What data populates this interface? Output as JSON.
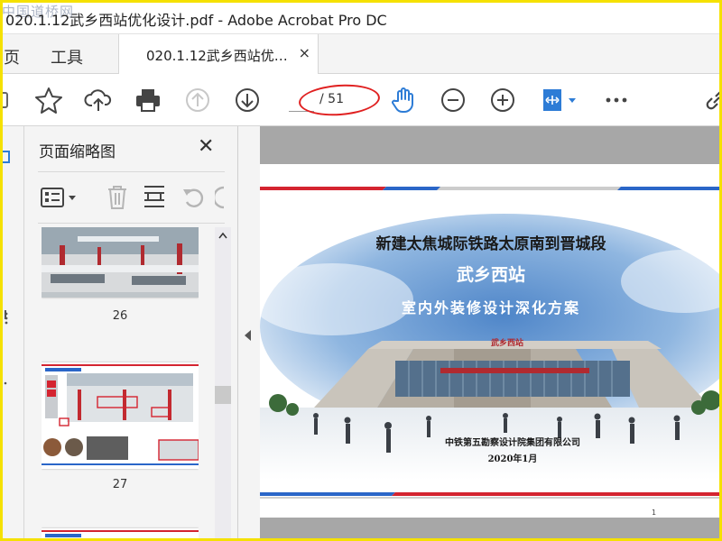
{
  "window": {
    "title": "020.1.12武乡西站优化设计.pdf - Adobe Acrobat Pro DC",
    "watermark": "中国道桥网"
  },
  "tabs": {
    "home_partial": "页",
    "tools": "工具",
    "document": "020.1.12武乡西站优…",
    "close_glyph": "×"
  },
  "toolbar": {
    "icons": [
      "star-icon",
      "cloud-upload-icon",
      "print-icon",
      "page-up-icon",
      "page-down-icon",
      "hand-tool-icon",
      "zoom-out-icon",
      "zoom-in-icon",
      "fit-page-icon",
      "more-icon",
      "link-icon"
    ],
    "page_current": "",
    "page_total": "/ 51",
    "accent": "#2d7cd6",
    "annotation_color": "#e02020"
  },
  "panel": {
    "title": "页面缩略图",
    "close_glyph": "✕",
    "pages": [
      {
        "number": "26"
      },
      {
        "number": "27"
      },
      {
        "number": ""
      }
    ]
  },
  "document": {
    "line1": "新建太焦城际铁路太原南到晋城段",
    "line2": "武乡西站",
    "line3": "室内外装修设计深化方案",
    "station_sign": "武乡西站",
    "org": "中铁第五勘察设计院集团有限公司",
    "date": "2020年1月",
    "page_no": "1"
  },
  "colors": {
    "frame": "#f5e100",
    "red_stripe": "#d42430",
    "blue_stripe": "#2a66c8",
    "title_blue": "#ffffff"
  }
}
